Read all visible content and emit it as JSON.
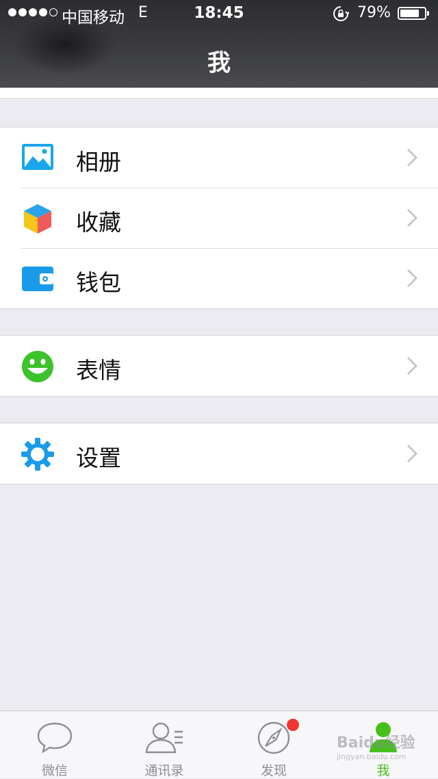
{
  "status_bar": {
    "carrier": "中国移动",
    "network": "E",
    "time": "18:45",
    "battery_percent": "79%",
    "battery_level": 0.79,
    "signal_bars_filled": 4,
    "signal_bars_total": 5
  },
  "header": {
    "title": "我"
  },
  "groups": [
    {
      "items": [
        {
          "label": "相册",
          "icon": "album-icon"
        },
        {
          "label": "收藏",
          "icon": "favorites-icon"
        },
        {
          "label": "钱包",
          "icon": "wallet-icon"
        }
      ]
    },
    {
      "items": [
        {
          "label": "表情",
          "icon": "sticker-icon"
        }
      ]
    },
    {
      "items": [
        {
          "label": "设置",
          "icon": "settings-gear-icon"
        }
      ]
    }
  ],
  "tabbar": {
    "tabs": [
      {
        "label": "微信",
        "icon": "chat-bubble-icon",
        "active": false
      },
      {
        "label": "通讯录",
        "icon": "contacts-icon",
        "active": false
      },
      {
        "label": "发现",
        "icon": "compass-icon",
        "active": false,
        "badge": true
      },
      {
        "label": "我",
        "icon": "person-icon",
        "active": true
      }
    ]
  },
  "watermark": {
    "text": "Baidu经验",
    "subtext": "jingyan.baidu.com"
  },
  "colors": {
    "accent_green": "#45c01a",
    "icon_blue": "#1a9bea",
    "badge_red": "#f43530",
    "background": "#ecebf1"
  }
}
